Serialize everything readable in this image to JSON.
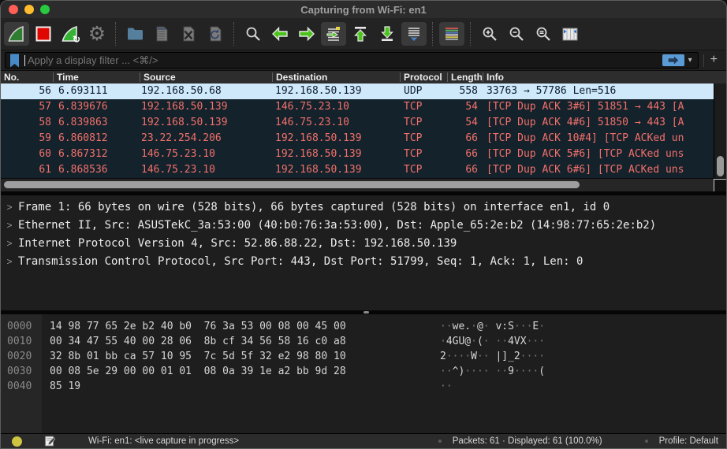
{
  "window": {
    "title": "Capturing from Wi-Fi: en1"
  },
  "colors": {
    "selected_row_bg": "#cfe8fa",
    "selected_row_text": "#0e1e30",
    "bad_tcp_bg": "#13222b",
    "bad_tcp_text": "#f4706b",
    "accent_blue": "#5b9bd5",
    "toolbar_green": "#4ac41a",
    "fin_green": "#2f7d31",
    "status_yellow": "#cfc342",
    "traffic_red": "#ff5f57",
    "traffic_yellow": "#febc2e",
    "traffic_green": "#28c840"
  },
  "toolbar": {
    "glyphs": {
      "gear": "⚙",
      "caret": "▾",
      "restart_arrow": "↻"
    }
  },
  "filter": {
    "placeholder": "Apply a display filter ... <⌘/>",
    "add_button": "+"
  },
  "packet_list": {
    "columns": [
      "No.",
      "Time",
      "Source",
      "Destination",
      "Protocol",
      "Length",
      "Info"
    ],
    "rows": [
      {
        "no": "56",
        "time": "6.693111",
        "source": "192.168.50.68",
        "destination": "192.168.50.139",
        "protocol": "UDP",
        "length": "558",
        "info": "33763 → 57786 Len=516",
        "selected": true
      },
      {
        "no": "57",
        "time": "6.839676",
        "source": "192.168.50.139",
        "destination": "146.75.23.10",
        "protocol": "TCP",
        "length": "54",
        "info": "[TCP Dup ACK 3#6] 51851 → 443 [A",
        "selected": false
      },
      {
        "no": "58",
        "time": "6.839863",
        "source": "192.168.50.139",
        "destination": "146.75.23.10",
        "protocol": "TCP",
        "length": "54",
        "info": "[TCP Dup ACK 4#6] 51850 → 443 [A",
        "selected": false
      },
      {
        "no": "59",
        "time": "6.860812",
        "source": "23.22.254.206",
        "destination": "192.168.50.139",
        "protocol": "TCP",
        "length": "66",
        "info": "[TCP Dup ACK 10#4] [TCP ACKed un",
        "selected": false
      },
      {
        "no": "60",
        "time": "6.867312",
        "source": "146.75.23.10",
        "destination": "192.168.50.139",
        "protocol": "TCP",
        "length": "66",
        "info": "[TCP Dup ACK 5#6] [TCP ACKed uns",
        "selected": false
      },
      {
        "no": "61",
        "time": "6.868536",
        "source": "146.75.23.10",
        "destination": "192.168.50.139",
        "protocol": "TCP",
        "length": "66",
        "info": "[TCP Dup ACK 6#6] [TCP ACKed uns",
        "selected": false
      }
    ]
  },
  "details": {
    "chevron": ">",
    "lines": [
      "Frame 1: 66 bytes on wire (528 bits), 66 bytes captured (528 bits) on interface en1, id 0",
      "Ethernet II, Src: ASUSTekC_3a:53:00 (40:b0:76:3a:53:00), Dst: Apple_65:2e:b2 (14:98:77:65:2e:b2)",
      "Internet Protocol Version 4, Src: 52.86.88.22, Dst: 192.168.50.139",
      "Transmission Control Protocol, Src Port: 443, Dst Port: 51799, Seq: 1, Ack: 1, Len: 0"
    ]
  },
  "hex": {
    "rows": [
      {
        "offset": "0000",
        "bytes": "14 98 77 65 2e b2 40 b0  76 3a 53 00 08 00 45 00",
        "ascii": "··we.·@· v:S···E·"
      },
      {
        "offset": "0010",
        "bytes": "00 34 47 55 40 00 28 06  8b cf 34 56 58 16 c0 a8",
        "ascii": "·4GU@·(· ··4VX···"
      },
      {
        "offset": "0020",
        "bytes": "32 8b 01 bb ca 57 10 95  7c 5d 5f 32 e2 98 80 10",
        "ascii": "2····W·· |]_2····"
      },
      {
        "offset": "0030",
        "bytes": "00 08 5e 29 00 00 01 01  08 0a 39 1e a2 bb 9d 28",
        "ascii": "··^)···· ··9····("
      },
      {
        "offset": "0040",
        "bytes": "85 19",
        "ascii": "··"
      }
    ]
  },
  "status": {
    "interface": "Wi-Fi: en1: <live capture in progress>",
    "packets": "Packets: 61 · Displayed: 61 (100.0%)",
    "profile": "Profile: Default"
  }
}
